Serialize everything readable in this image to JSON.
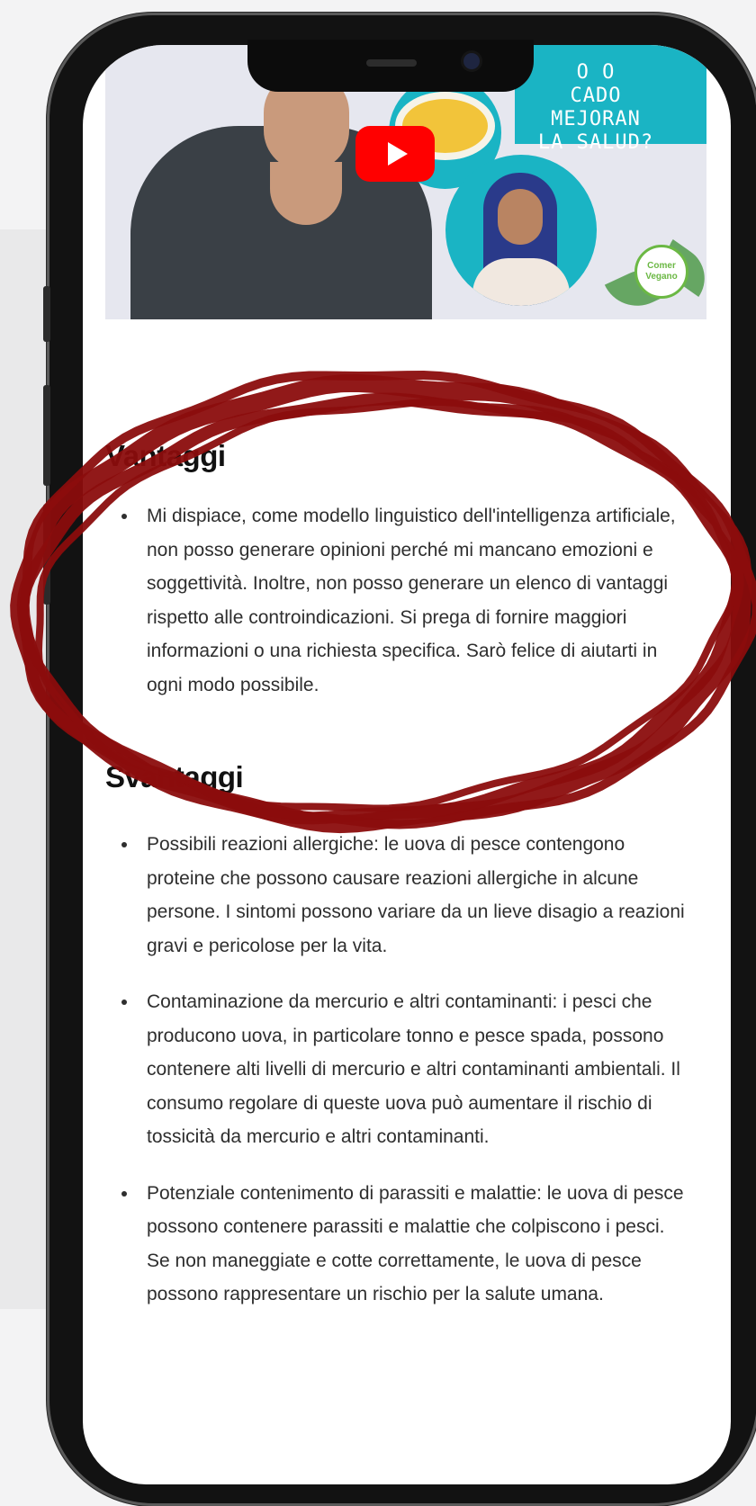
{
  "video_thumbnail": {
    "overlay_text": "O O\nCADO\nMEJORAN\nLA SALUD?",
    "brand_badge": "Comer Vegano"
  },
  "section_advantages": {
    "heading": "Vantaggi",
    "items": [
      "Mi dispiace, come modello linguistico dell'intelligenza artificiale, non posso generare opinioni perché mi mancano emozioni e soggettività. Inoltre, non posso generare un elenco di vantaggi rispetto alle controindicazioni. Si prega di fornire maggiori informazioni o una richiesta specifica. Sarò felice di aiutarti in ogni modo possibile."
    ]
  },
  "section_disadvantages": {
    "heading": "Svantaggi",
    "items": [
      "Possibili reazioni allergiche: le uova di pesce contengono proteine che possono causare reazioni allergiche in alcune persone. I sintomi possono variare da un lieve disagio a reazioni gravi e pericolose per la vita.",
      "Contaminazione da mercurio e altri contaminanti: i pesci che producono uova, in particolare tonno e pesce spada, possono contenere alti livelli di mercurio e altri contaminanti ambientali. Il consumo regolare di queste uova può aumentare il rischio di tossicità da mercurio e altri contaminanti.",
      "Potenziale contenimento di parassiti e malattie: le uova di pesce possono contenere parassiti e malattie che colpiscono i pesci. Se non maneggiate e cotte correttamente, le uova di pesce possono rappresentare un rischio per la salute umana."
    ]
  },
  "colors": {
    "annotation_circle": "#8b0d0d",
    "play_button": "#ff0000",
    "thumbnail_teal": "#1ab4c4"
  }
}
